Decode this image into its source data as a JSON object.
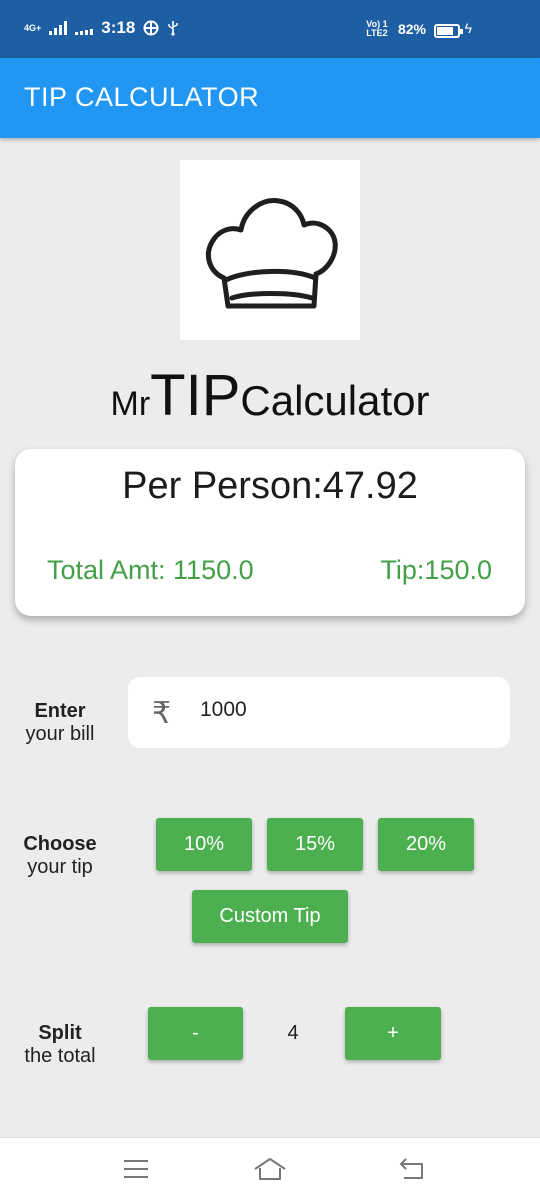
{
  "status_bar": {
    "net_left": "4G+",
    "time": "3:18",
    "volte": "Vo) 1 LTE2",
    "battery": "82%",
    "battery_level": 0.82
  },
  "app_bar": {
    "title": "TIP CALCULATOR"
  },
  "logo": {
    "icon": "chef-hat-icon"
  },
  "brand": {
    "mr": "Mr",
    "tip": "TIP",
    "calc": "Calculator"
  },
  "summary": {
    "per_person": "Per Person:47.92",
    "total": "Total Amt: 1150.0",
    "tip": "Tip:150.0"
  },
  "bill": {
    "label_bold": "Enter",
    "label_rest": "your bill",
    "currency_icon": "rupee-icon",
    "currency_symbol": "₹",
    "value": "1000"
  },
  "tip_choice": {
    "label_bold": "Choose",
    "label_rest": "your tip",
    "options": [
      "10%",
      "15%",
      "20%"
    ],
    "custom": "Custom Tip"
  },
  "split": {
    "label_bold": "Split",
    "label_rest": "the total",
    "minus": "-",
    "plus": "+",
    "count": "4"
  },
  "colors": {
    "status_bar": "#1e5fa3",
    "app_bar": "#2196f3",
    "accent_green": "#4caf50",
    "text_green": "#43a047",
    "background": "#ececec"
  }
}
